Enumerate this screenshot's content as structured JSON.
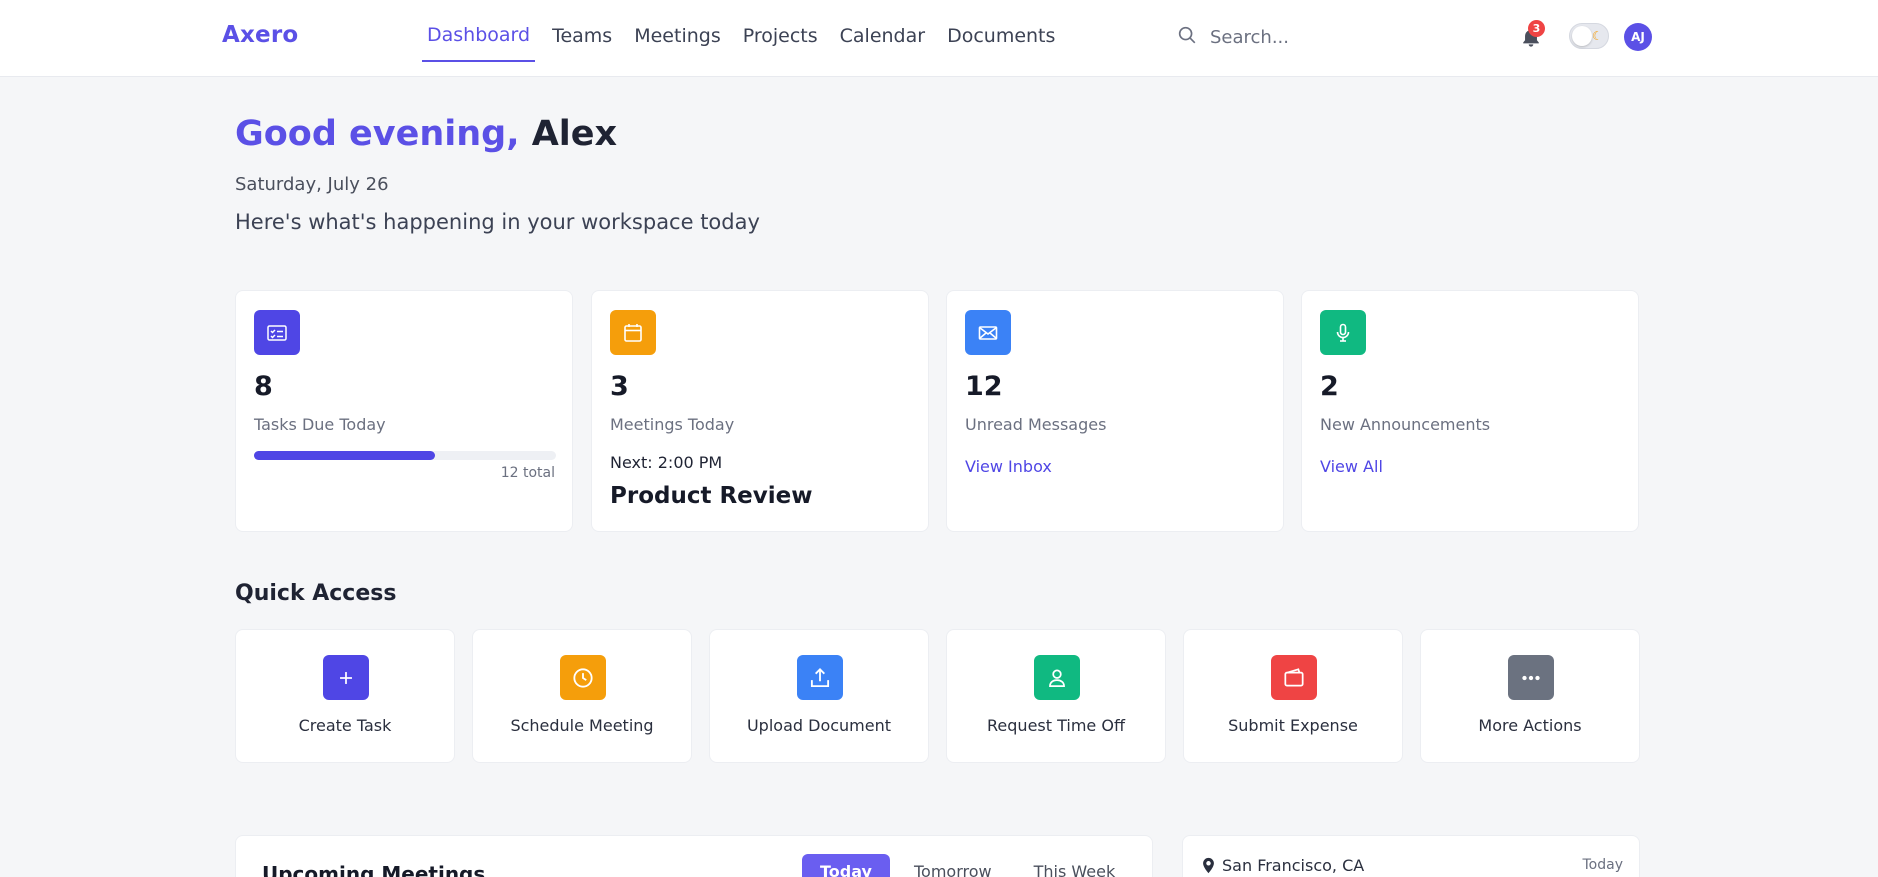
{
  "app": {
    "logo": "Axero"
  },
  "nav": {
    "items": [
      {
        "label": "Dashboard"
      },
      {
        "label": "Teams"
      },
      {
        "label": "Meetings"
      },
      {
        "label": "Projects"
      },
      {
        "label": "Calendar"
      },
      {
        "label": "Documents"
      }
    ],
    "active": "Dashboard"
  },
  "header": {
    "search_placeholder": "Search...",
    "notification_count": "3",
    "avatar_initials": "AJ",
    "theme_toggle": "light"
  },
  "greeting": {
    "prefix": "Good evening,",
    "name": "Alex",
    "date": "Saturday, July 26",
    "subtitle": "Here's what's happening in your workspace today"
  },
  "stats": {
    "tasks": {
      "value": "8",
      "label": "Tasks Due Today",
      "total": "12 total",
      "progress_fraction": 0.6,
      "icon": "checklist-icon",
      "color": "#4f46e5"
    },
    "meetings": {
      "value": "3",
      "label": "Meetings Today",
      "next": "Next: 2:00 PM",
      "next_title": "Product Review",
      "icon": "calendar-icon",
      "color": "#f59e0b"
    },
    "messages": {
      "value": "12",
      "label": "Unread Messages",
      "link": "View Inbox",
      "icon": "mail-icon",
      "color": "#3b82f6"
    },
    "announcements": {
      "value": "2",
      "label": "New Announcements",
      "link": "View All",
      "icon": "microphone-icon",
      "color": "#10b981"
    }
  },
  "quick_access": {
    "title": "Quick Access",
    "items": [
      {
        "label": "Create Task",
        "icon": "plus-icon",
        "color": "#4f46e5"
      },
      {
        "label": "Schedule Meeting",
        "icon": "clock-icon",
        "color": "#f59e0b"
      },
      {
        "label": "Upload Document",
        "icon": "upload-icon",
        "color": "#3b82f6"
      },
      {
        "label": "Request Time Off",
        "icon": "user-icon",
        "color": "#10b981"
      },
      {
        "label": "Submit Expense",
        "icon": "wallet-icon",
        "color": "#ef4444"
      },
      {
        "label": "More Actions",
        "icon": "more-icon",
        "color": "#6b7280"
      }
    ]
  },
  "meetings_panel": {
    "title": "Upcoming Meetings",
    "tabs": [
      {
        "label": "Today"
      },
      {
        "label": "Tomorrow"
      },
      {
        "label": "This Week"
      }
    ],
    "active_tab": "Today"
  },
  "weather": {
    "location": "San Francisco, CA",
    "when": "Today"
  }
}
